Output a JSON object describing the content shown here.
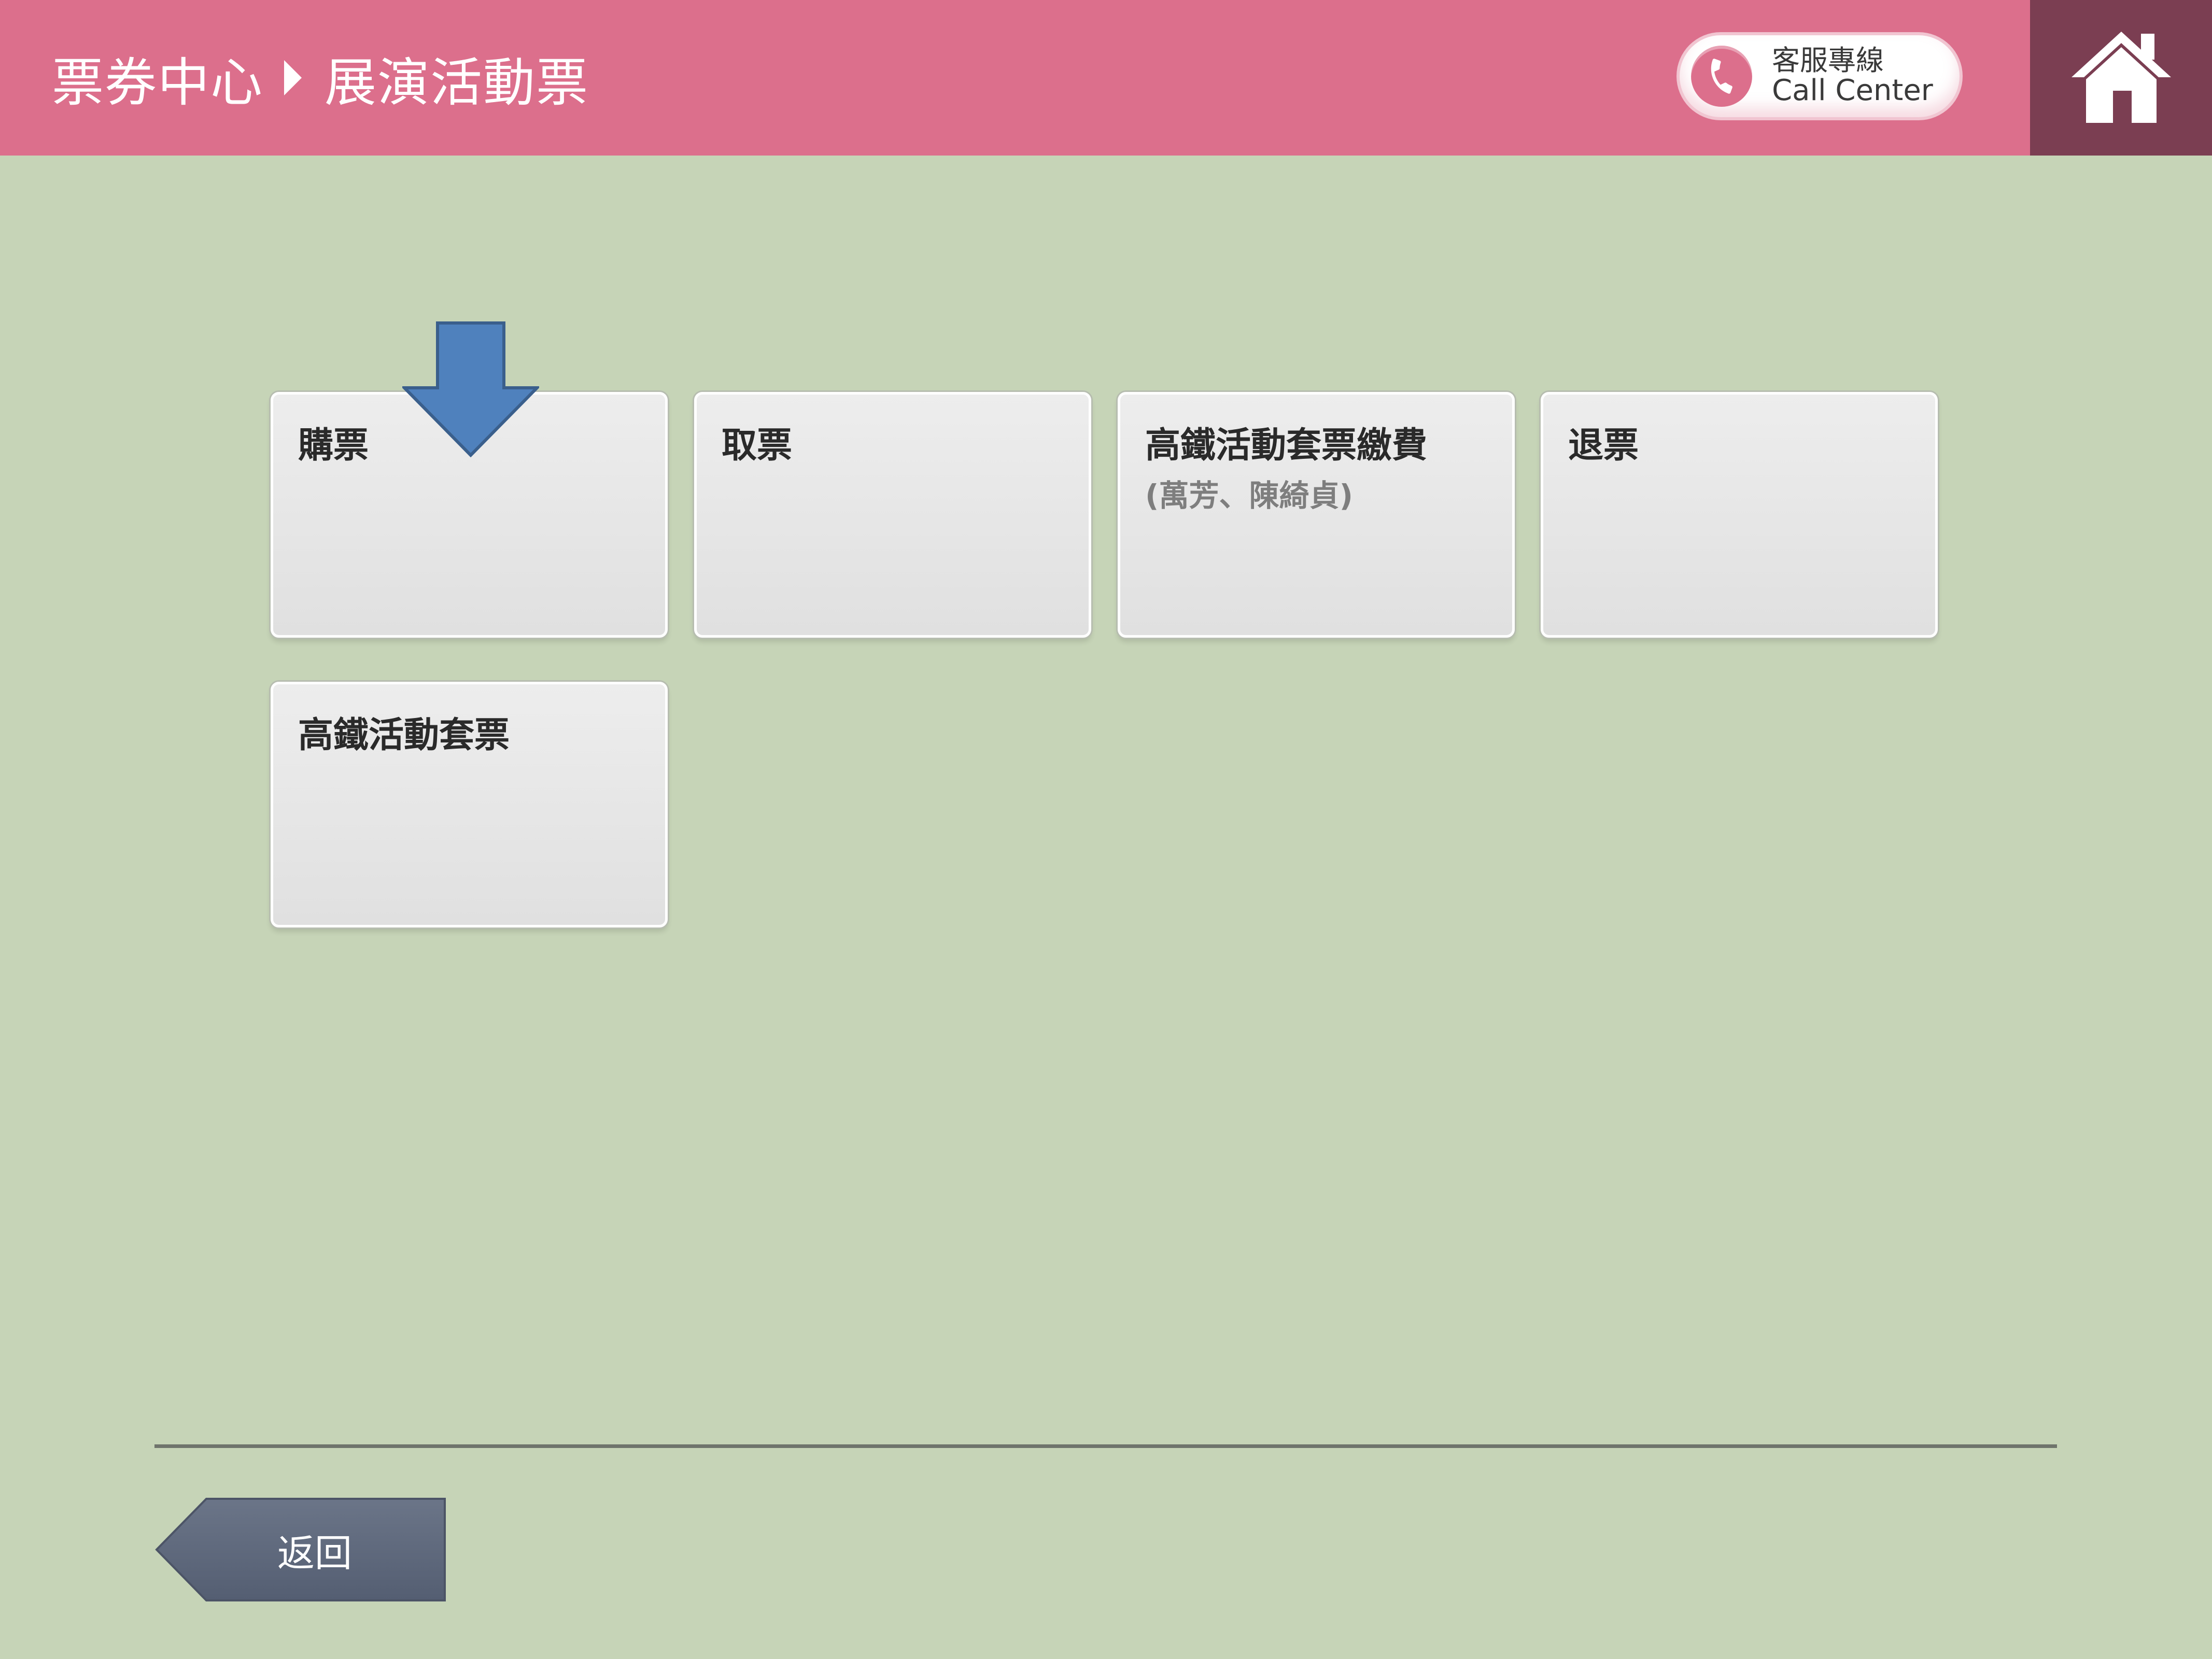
{
  "header": {
    "breadcrumb_root": "票券中心",
    "breadcrumb_current": "展演活動票",
    "call_center_line1": "客服專線",
    "call_center_line2": "Call Center"
  },
  "tiles": [
    {
      "label": "購票",
      "sublabel": ""
    },
    {
      "label": "取票",
      "sublabel": ""
    },
    {
      "label": "高鐵活動套票繳費",
      "sublabel": "(萬芳、陳綺貞)"
    },
    {
      "label": "退票",
      "sublabel": ""
    },
    {
      "label": "高鐵活動套票",
      "sublabel": ""
    }
  ],
  "footer": {
    "back_label": "返回"
  },
  "colors": {
    "header_bg": "#dc6f8c",
    "home_bg": "#7b3e52",
    "page_bg": "#c6d4b7",
    "arrow": "#4f81bd",
    "back_button": "#5f6b80"
  },
  "icons": {
    "phone": "phone-icon",
    "home": "home-icon",
    "pointer": "down-arrow-icon"
  }
}
